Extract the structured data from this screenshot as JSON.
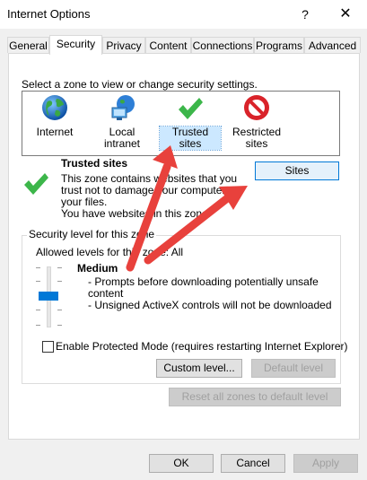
{
  "window": {
    "title": "Internet Options",
    "help_glyph": "?",
    "close_glyph": "✕"
  },
  "tabs": [
    {
      "label": "General"
    },
    {
      "label": "Security"
    },
    {
      "label": "Privacy"
    },
    {
      "label": "Content"
    },
    {
      "label": "Connections"
    },
    {
      "label": "Programs"
    },
    {
      "label": "Advanced"
    }
  ],
  "active_tab": "Security",
  "zones": {
    "prompt": "Select a zone to view or change security settings.",
    "items": [
      {
        "label": "Internet",
        "icon": "globe-icon"
      },
      {
        "label": "Local intranet",
        "icon": "network-icon"
      },
      {
        "label": "Trusted sites",
        "icon": "checkmark-icon"
      },
      {
        "label_line1": "Restricted",
        "label_line2": "sites",
        "icon": "no-entry-icon"
      }
    ],
    "selected": "Trusted sites"
  },
  "zone_info": {
    "heading": "Trusted sites",
    "desc_line1": "This zone contains websites that you",
    "desc_line2": "trust not to damage your computer or",
    "desc_line3": "your files.",
    "desc_line4": "You have websites in this zone.",
    "sites_button": "Sites"
  },
  "security_level": {
    "group_label": "Security level for this zone",
    "allowed_label": "Allowed levels for this zone: All",
    "level_name": "Medium",
    "bullet1_line1": "- Prompts before downloading potentially unsafe",
    "bullet1_line2": "content",
    "bullet2": "- Unsigned ActiveX controls will not be downloaded",
    "slider_level": 0.5,
    "protected_mode_label": "Enable Protected Mode (requires restarting Internet Explorer)",
    "protected_mode_checked": false,
    "custom_level_button": "Custom level...",
    "default_level_button": "Default level"
  },
  "reset_all_button": "Reset all zones to default level",
  "footer": {
    "ok": "OK",
    "cancel": "Cancel",
    "apply": "Apply"
  },
  "colors": {
    "accent": "#0078d7",
    "arrow": "#e8413c",
    "check_green": "#3cb64a",
    "restricted_red": "#d9232a"
  }
}
